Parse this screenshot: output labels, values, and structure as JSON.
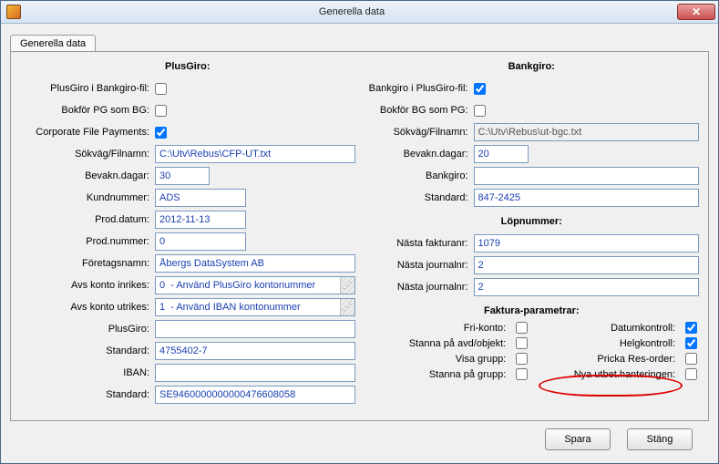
{
  "window": {
    "title": "Generella data",
    "close_glyph": "✕"
  },
  "tabs": {
    "active": "Generella data"
  },
  "plusgiro": {
    "header": "PlusGiro:",
    "labels": {
      "pg_i_bg_fil": "PlusGiro i Bankgiro-fil:",
      "bokfor_pg_som_bg": "Bokför PG som BG:",
      "corp_file_payments": "Corporate File Payments:",
      "sokvag_filnamn": "Sökväg/Filnamn:",
      "bevakn_dagar": "Bevakn.dagar:",
      "kundnummer": "Kundnummer:",
      "prod_datum": "Prod.datum:",
      "prod_nummer": "Prod.nummer:",
      "foretagsnamn": "Företagsnamn:",
      "avs_konto_inrikes": "Avs konto inrikes:",
      "avs_konto_utrikes": "Avs konto utrikes:",
      "plusgiro": "PlusGiro:",
      "standard": "Standard:",
      "iban": "IBAN:",
      "standard2": "Standard:"
    },
    "values": {
      "pg_i_bg_fil": false,
      "bokfor_pg_som_bg": false,
      "corp_file_payments": true,
      "sokvag_filnamn": "C:\\Utv\\Rebus\\CFP-UT.txt",
      "bevakn_dagar": "30",
      "kundnummer": "ADS",
      "prod_datum": "2012-11-13",
      "prod_nummer": "0",
      "foretagsnamn": "Åbergs DataSystem AB",
      "avs_konto_inrikes": "0  - Använd PlusGiro kontonummer",
      "avs_konto_utrikes": "1  - Använd IBAN kontonummer",
      "plusgiro": "",
      "standard": "4755402-7",
      "iban": "",
      "standard2": "SE9460000000000476608058"
    }
  },
  "bankgiro": {
    "header": "Bankgiro:",
    "labels": {
      "bg_i_pg_fil": "Bankgiro i PlusGiro-fil:",
      "bokfor_bg_som_pg": "Bokför BG som PG:",
      "sokvag_filnamn": "Sökväg/Filnamn:",
      "bevakn_dagar": "Bevakn.dagar:",
      "bankgiro": "Bankgiro:",
      "standard": "Standard:"
    },
    "values": {
      "bg_i_pg_fil": true,
      "bokfor_bg_som_pg": false,
      "sokvag_filnamn": "C:\\Utv\\Rebus\\ut-bgc.txt",
      "bevakn_dagar": "20",
      "bankgiro": "",
      "standard": "847-2425"
    }
  },
  "lopnummer": {
    "header": "Löpnummer:",
    "labels": {
      "nasta_fakturanr": "Nästa fakturanr:",
      "nasta_journalnr1": "Nästa journalnr:",
      "nasta_journalnr2": "Nästa journalnr:"
    },
    "values": {
      "nasta_fakturanr": "1079",
      "nasta_journalnr1": "2",
      "nasta_journalnr2": "2"
    }
  },
  "faktura": {
    "header": "Faktura-parametrar:",
    "labels": {
      "fri_konto": "Fri-konto:",
      "datumkontroll": "Datumkontroll:",
      "stanna_avd": "Stanna på avd/objekt:",
      "helgkontroll": "Helgkontroll:",
      "visa_grupp": "Visa grupp:",
      "pricka_resorder": "Pricka Res-order:",
      "stanna_grupp": "Stanna på grupp:",
      "nya_utbet": "Nya utbet.hanteringen:"
    },
    "values": {
      "fri_konto": false,
      "datumkontroll": true,
      "stanna_avd": false,
      "helgkontroll": true,
      "visa_grupp": false,
      "pricka_resorder": false,
      "stanna_grupp": false,
      "nya_utbet": false
    }
  },
  "buttons": {
    "save": "Spara",
    "close": "Stäng"
  }
}
